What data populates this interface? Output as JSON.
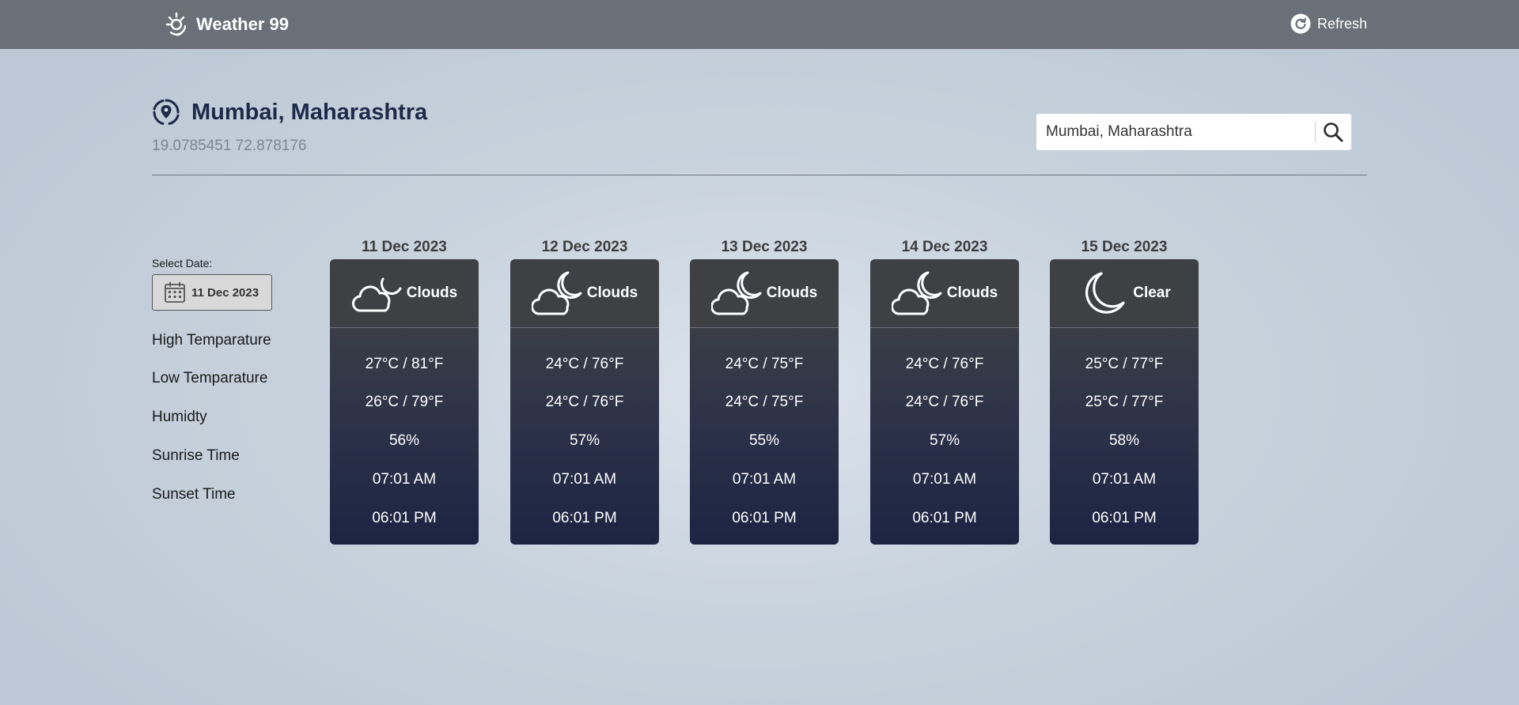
{
  "app": {
    "title": "Weather 99",
    "refresh_label": "Refresh"
  },
  "location": {
    "name": "Mumbai, Maharashtra",
    "coordinates": "19.0785451 72.878176"
  },
  "search": {
    "value": "Mumbai, Maharashtra",
    "icon": "search-icon"
  },
  "date_selector": {
    "label": "Select Date:",
    "value": "11 Dec 2023",
    "icon": "calendar-icon"
  },
  "row_labels": {
    "high": "High Temparature",
    "low": "Low Temparature",
    "humidity": "Humidty",
    "sunrise": "Sunrise Time",
    "sunset": "Sunset Time"
  },
  "days": [
    {
      "date": "11 Dec 2023",
      "condition": "Clouds",
      "icon": "cloud-moon-icon",
      "high": "27°C / 81°F",
      "low": "26°C / 79°F",
      "humidity": "56%",
      "sunrise": "07:01 AM",
      "sunset": "06:01 PM"
    },
    {
      "date": "12 Dec 2023",
      "condition": "Clouds",
      "icon": "cloud-moon-icon",
      "high": "24°C / 76°F",
      "low": "24°C / 76°F",
      "humidity": "57%",
      "sunrise": "07:01 AM",
      "sunset": "06:01 PM"
    },
    {
      "date": "13 Dec 2023",
      "condition": "Clouds",
      "icon": "cloud-moon-icon",
      "high": "24°C / 75°F",
      "low": "24°C / 75°F",
      "humidity": "55%",
      "sunrise": "07:01 AM",
      "sunset": "06:01 PM"
    },
    {
      "date": "14 Dec 2023",
      "condition": "Clouds",
      "icon": "cloud-moon-icon",
      "high": "24°C / 76°F",
      "low": "24°C / 76°F",
      "humidity": "57%",
      "sunrise": "07:01 AM",
      "sunset": "06:01 PM"
    },
    {
      "date": "15 Dec 2023",
      "condition": "Clear",
      "icon": "moon-icon",
      "high": "25°C / 77°F",
      "low": "25°C / 77°F",
      "humidity": "58%",
      "sunrise": "07:01 AM",
      "sunset": "06:01 PM"
    }
  ],
  "colors": {
    "topbar": "#6a6f78",
    "title_text": "#1c2a48",
    "card_top": "#3f4044",
    "card_bottom": "#1c2442"
  }
}
